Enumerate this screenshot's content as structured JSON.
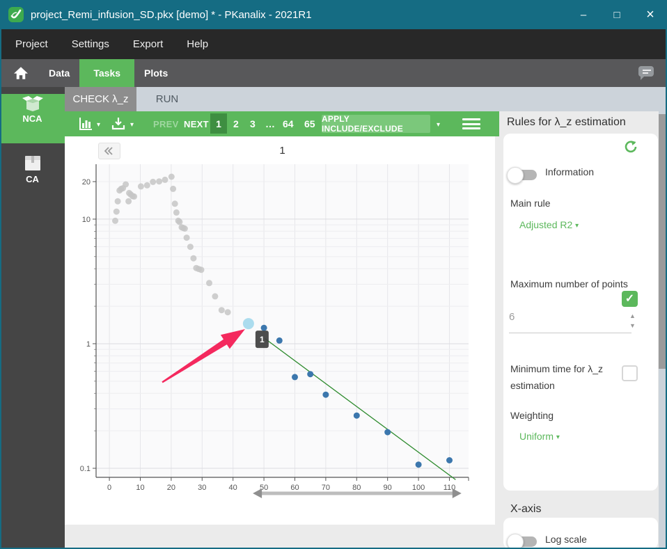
{
  "window": {
    "title": "project_Remi_infusion_SD.pkx [demo] * - PKanalix - 2021R1"
  },
  "icons": {
    "caret_down": "▾",
    "minimize": "–",
    "maximize": "□",
    "close": "×",
    "check": "✓",
    "spinner_up": "▲",
    "spinner_down": "▼"
  },
  "menu": {
    "items": [
      "Project",
      "Settings",
      "Export",
      "Help"
    ]
  },
  "nav": {
    "items": [
      "Data",
      "Tasks",
      "Plots"
    ],
    "active": "Tasks"
  },
  "sidebar": {
    "items": [
      {
        "label": "NCA",
        "active": true
      },
      {
        "label": "CA",
        "active": false
      }
    ]
  },
  "tabs": {
    "items": [
      {
        "label": "CHECK λ_z",
        "active": true
      },
      {
        "label": "RUN",
        "active": false
      }
    ]
  },
  "toolbar": {
    "prev_label": "PREV",
    "next_label": "NEXT",
    "pages": [
      "1",
      "2",
      "3",
      "…",
      "64",
      "65"
    ],
    "active_page": "1",
    "apply_label": "APPLY INCLUDE/EXCLUDE"
  },
  "panel": {
    "heading": "Rules for λ_z estimation",
    "information_label": "Information",
    "information_on": false,
    "main_rule_label": "Main rule",
    "main_rule_value": "Adjusted R2",
    "max_points_label": "Maximum number of points",
    "max_points_enabled": true,
    "max_points_value": "6",
    "min_time_label_line1": "Minimum time for λ_z",
    "min_time_label_line2": "estimation",
    "min_time_enabled": false,
    "weighting_label": "Weighting",
    "weighting_value": "Uniform",
    "xaxis_heading": "X-axis",
    "log_scale_label": "Log scale",
    "log_scale_on": false
  },
  "colors": {
    "accent_green": "#5cb85c",
    "active_page_green": "#3e8e41",
    "titlebar_teal": "#156c83",
    "excluded_gray": "#c6c6c6",
    "included_blue": "#3c77ad",
    "highlight_blue": "#abdcee",
    "regression_green": "#2e8b2e",
    "arrow_pink": "#f4295e"
  },
  "chart_data": {
    "type": "scatter",
    "title": "1",
    "y_scale": "log",
    "xlim": [
      -4.3,
      116.2
    ],
    "ylim": [
      0.0846,
      27.6
    ],
    "x_ticks": [
      0,
      10,
      20,
      30,
      40,
      50,
      60,
      70,
      80,
      90,
      100,
      110
    ],
    "y_tick_labels": [
      20,
      10,
      1,
      0.1
    ],
    "y_major": [
      10,
      1,
      0.1
    ],
    "y_minor": [
      20,
      9,
      8,
      7,
      6,
      5,
      4,
      3,
      2,
      0.9,
      0.8,
      0.7,
      0.6,
      0.5,
      0.4,
      0.3,
      0.2
    ],
    "series": [
      {
        "name": "excluded",
        "points": [
          [
            1.9,
            9.7
          ],
          [
            2.3,
            11.5
          ],
          [
            2.7,
            13.9
          ],
          [
            3.3,
            17.0
          ],
          [
            3.8,
            17.5
          ],
          [
            4.4,
            17.7
          ],
          [
            5.3,
            19.0
          ],
          [
            6.2,
            13.9
          ],
          [
            6.4,
            16.2
          ],
          [
            6.9,
            15.8
          ],
          [
            7.5,
            15.3
          ],
          [
            8.0,
            15.2
          ],
          [
            10.2,
            18.3
          ],
          [
            12.2,
            18.7
          ],
          [
            14.1,
            19.9
          ],
          [
            16.1,
            20.1
          ],
          [
            18.0,
            20.7
          ],
          [
            20.1,
            21.9
          ],
          [
            20.6,
            17.5
          ],
          [
            21.2,
            13.3
          ],
          [
            21.7,
            11.3
          ],
          [
            22.3,
            9.7
          ],
          [
            22.7,
            9.5
          ],
          [
            23.4,
            8.6
          ],
          [
            23.9,
            8.5
          ],
          [
            24.4,
            8.4
          ],
          [
            25.0,
            7.1
          ],
          [
            26.2,
            6.0
          ],
          [
            27.2,
            4.85
          ],
          [
            28.1,
            4.05
          ],
          [
            28.9,
            3.98
          ],
          [
            29.7,
            3.92
          ],
          [
            32.3,
            3.07
          ],
          [
            34.2,
            2.4
          ],
          [
            36.3,
            1.86
          ],
          [
            38.3,
            1.79
          ]
        ]
      },
      {
        "name": "included",
        "points": [
          [
            50,
            1.34
          ],
          [
            55,
            1.06
          ],
          [
            60,
            0.54
          ],
          [
            65,
            0.57
          ],
          [
            70,
            0.39
          ],
          [
            80,
            0.265
          ],
          [
            90,
            0.195
          ],
          [
            100,
            0.107
          ],
          [
            110,
            0.116
          ]
        ]
      }
    ],
    "highlighted_point": [
      45,
      1.45
    ],
    "tooltip_label": "1",
    "regression_line": {
      "from": [
        50.3,
        1.1
      ],
      "to": [
        112,
        0.081
      ]
    },
    "annotation_arrow": {
      "tip": [
        43.9,
        1.31
      ],
      "tail": [
        17.1,
        0.49
      ]
    },
    "pan_slider": {
      "t_from": 46.4,
      "t_to": 113.9
    }
  }
}
